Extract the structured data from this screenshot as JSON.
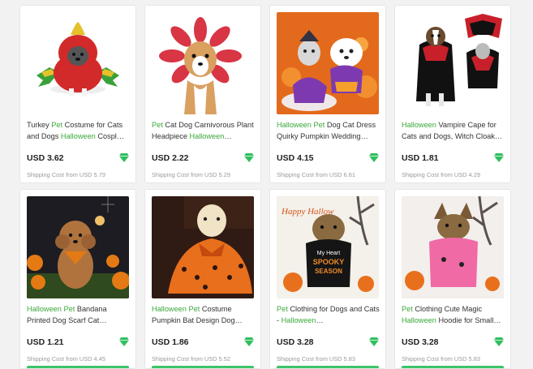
{
  "products": [
    {
      "title": [
        {
          "t": "Turkey "
        },
        {
          "t": "Pet",
          "k": true
        },
        {
          "t": " Costume for Cats and Dogs "
        },
        {
          "t": "Halloween",
          "k": true
        },
        {
          "t": " Cospl…"
        }
      ],
      "price": "USD 3.62",
      "shipping": "Shipping Cost from USD 5.79",
      "image": "turkey-costume"
    },
    {
      "title": [
        {
          "t": "Pet",
          "k": true
        },
        {
          "t": " Cat Dog Carnivorous Plant Headpiece "
        },
        {
          "t": "Halloween",
          "k": true
        },
        {
          "t": "…"
        }
      ],
      "price": "USD 2.22",
      "shipping": "Shipping Cost from USD 5.29",
      "image": "plant-headpiece"
    },
    {
      "title": [
        {
          "t": "Halloween",
          "k": true
        },
        {
          "t": " "
        },
        {
          "t": "Pet",
          "k": true
        },
        {
          "t": " Dog Cat Dress Quirky Pumpkin Wedding…"
        }
      ],
      "price": "USD 4.15",
      "shipping": "Shipping Cost from USD 6.61",
      "image": "pumpkin-dress"
    },
    {
      "title": [
        {
          "t": "Halloween",
          "k": true
        },
        {
          "t": " Vampire Cape for Cats and Dogs, Witch Cloak…"
        }
      ],
      "price": "USD 1.81",
      "shipping": "Shipping Cost from USD 4.29",
      "image": "vampire-cape"
    },
    {
      "title": [
        {
          "t": "Halloween",
          "k": true
        },
        {
          "t": " "
        },
        {
          "t": "Pet",
          "k": true
        },
        {
          "t": " Bandana Printed Dog Scarf Cat…"
        }
      ],
      "price": "USD 1.21",
      "shipping": "Shipping Cost from USD 4.45",
      "image": "bandana"
    },
    {
      "title": [
        {
          "t": "Halloween",
          "k": true
        },
        {
          "t": " "
        },
        {
          "t": "Pet",
          "k": true
        },
        {
          "t": " Costume Pumpkin Bat Design Dog…"
        }
      ],
      "price": "USD 1.86",
      "shipping": "Shipping Cost from USD 5.52",
      "image": "bat-dress"
    },
    {
      "title": [
        {
          "t": "Pet",
          "k": true
        },
        {
          "t": " Clothing for Dogs and Cats - "
        },
        {
          "t": "Halloween",
          "k": true
        },
        {
          "t": "…"
        }
      ],
      "price": "USD 3.28",
      "shipping": "Shipping Cost from USD 5.83",
      "image": "spooky-hoodie",
      "image_text": [
        "My Heart",
        "SPOOKY",
        "SEASON"
      ],
      "scene_text": "Happy Hallow"
    },
    {
      "title": [
        {
          "t": "Pet",
          "k": true
        },
        {
          "t": " Clothing Cute Magic "
        },
        {
          "t": "Halloween",
          "k": true
        },
        {
          "t": " Hoodie for Small…"
        }
      ],
      "price": "USD 3.28",
      "shipping": "Shipping Cost from USD 5.83",
      "image": "pink-hoodie"
    }
  ],
  "colors": {
    "keyword": "#3aa83a",
    "gem": "#2fbf5f",
    "price": "#222222",
    "shipping": "#9a9a9a"
  },
  "icons": {
    "badge": "diamond-gem-icon"
  }
}
